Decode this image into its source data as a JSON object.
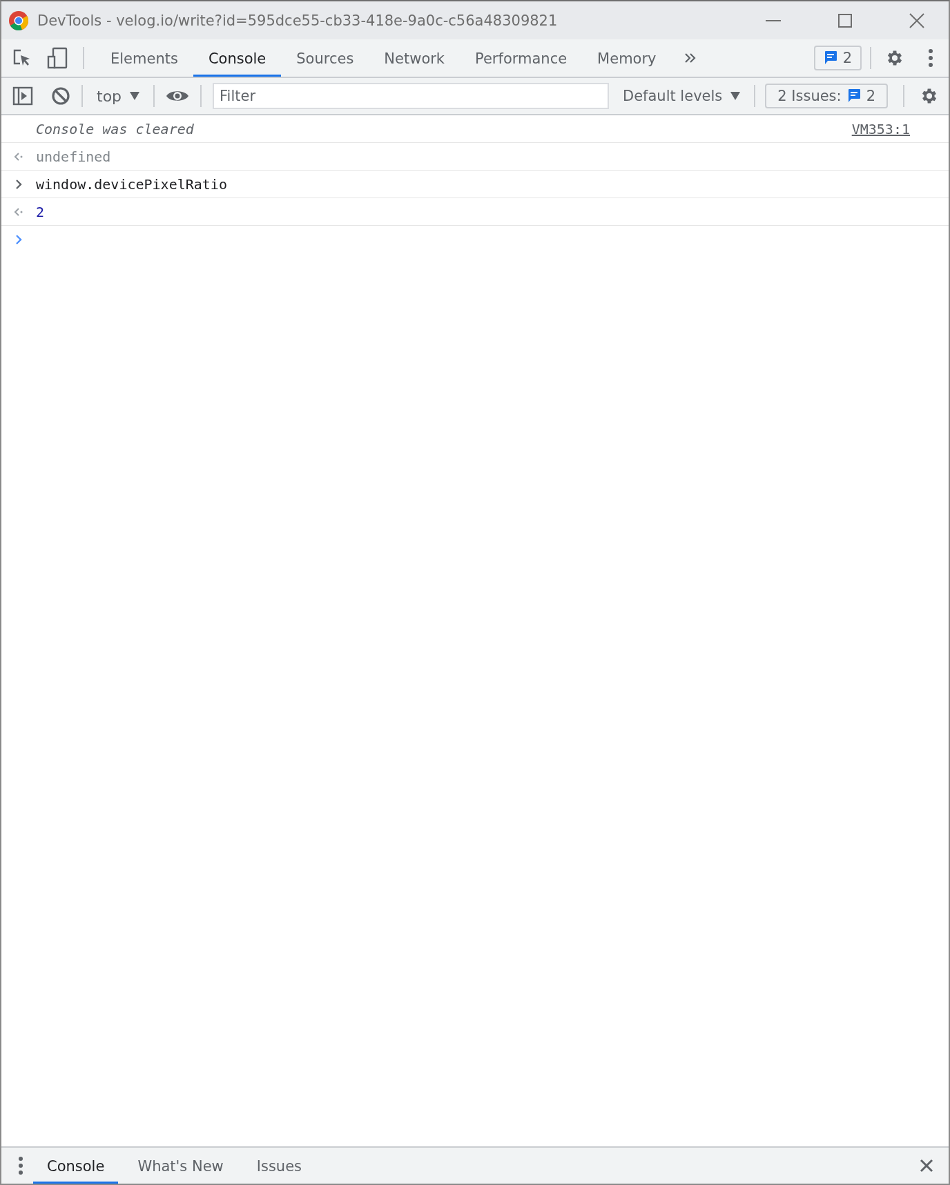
{
  "window": {
    "title": "DevTools - velog.io/write?id=595dce55-cb33-418e-9a0c-c56a48309821"
  },
  "tabs": [
    {
      "label": "Elements",
      "selected": false
    },
    {
      "label": "Console",
      "selected": true
    },
    {
      "label": "Sources",
      "selected": false
    },
    {
      "label": "Network",
      "selected": false
    },
    {
      "label": "Performance",
      "selected": false
    },
    {
      "label": "Memory",
      "selected": false
    }
  ],
  "messages_badge": {
    "count": "2"
  },
  "toolbar": {
    "context": "top",
    "filter": {
      "placeholder": "Filter"
    },
    "levels": "Default levels",
    "issues": {
      "label": "2 Issues:",
      "count": "2"
    }
  },
  "console": [
    {
      "kind": "info",
      "text": "Console was cleared",
      "source": "VM353:1"
    },
    {
      "kind": "result",
      "text": "undefined",
      "color": "#80868b"
    },
    {
      "kind": "input",
      "text": "window.devicePixelRatio"
    },
    {
      "kind": "result",
      "text": "2",
      "color": "#1a1aa6"
    },
    {
      "kind": "prompt"
    }
  ],
  "drawer_tabs": [
    {
      "label": "Console",
      "selected": true
    },
    {
      "label": "What's New",
      "selected": false
    },
    {
      "label": "Issues",
      "selected": false
    }
  ]
}
